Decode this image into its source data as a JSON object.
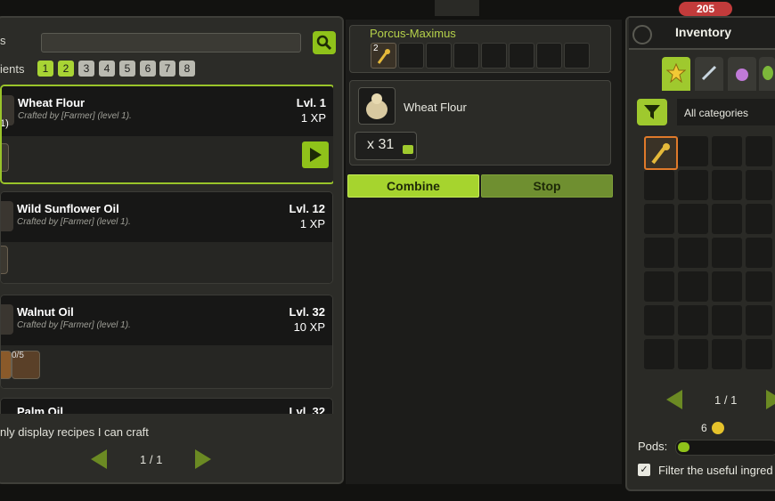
{
  "top": {
    "badge": "205"
  },
  "recipes_panel": {
    "search_label": "s",
    "ingredients_label": "ients",
    "levels": [
      "1",
      "2",
      "3",
      "4",
      "5",
      "6",
      "7",
      "8"
    ],
    "recipes": [
      {
        "name": "Wheat Flour",
        "crafted_by": "Crafted by [Farmer] (level 1).",
        "level": "Lvl. 1",
        "xp": "1 XP",
        "icon_badge": "1)"
      },
      {
        "name": "Wild Sunflower Oil",
        "crafted_by": "Crafted by [Farmer] (level 1).",
        "level": "Lvl. 12",
        "xp": "1 XP"
      },
      {
        "name": "Walnut Oil",
        "crafted_by": "Crafted by [Farmer] (level 1).",
        "level": "Lvl. 32",
        "xp": "10 XP",
        "ingredient_count": "0/5"
      },
      {
        "name": "Palm Oil",
        "level": "Lvl. 32"
      }
    ],
    "only_can_craft": "nly display recipes I can craft",
    "page": "1 / 1"
  },
  "craft_panel": {
    "workshop_title": "Porcus-Maximus",
    "slot_count": "2",
    "item_name": "Wheat Flour",
    "quantity": "x 31",
    "combine_label": "Combine",
    "stop_label": "Stop"
  },
  "inventory": {
    "title": "Inventory",
    "category": "All categories",
    "page": "1 / 1",
    "kamas": "6",
    "pods_label": "Pods:",
    "pods_fill": 0.12,
    "filter_label": "Filter the useful ingred"
  },
  "colors": {
    "accent": "#a6d42e",
    "panel": "#2a2a26",
    "bg": "#121210"
  },
  "icons": {
    "search": "search-icon",
    "play": "play-icon",
    "filter": "filter-icon",
    "wheat": "wheat-icon",
    "star": "star-icon",
    "sword": "sword-icon",
    "potion": "potion-icon",
    "leaf": "leaf-icon",
    "kamas": "kamas-icon"
  }
}
